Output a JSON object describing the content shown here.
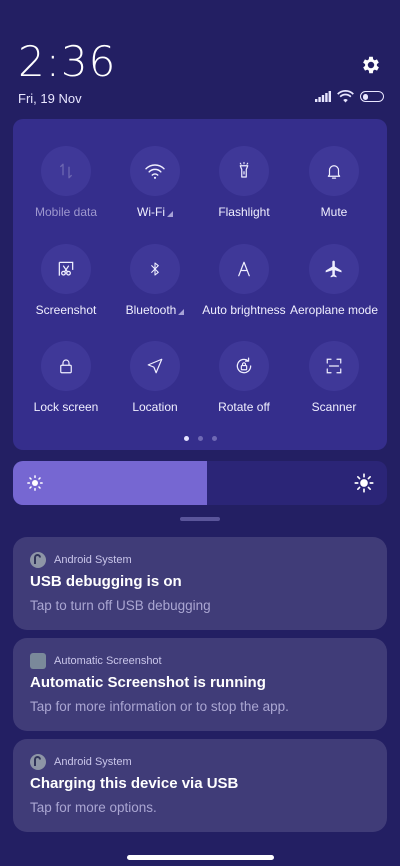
{
  "status_bar": {
    "time": "2:36",
    "date": "Fri, 19 Nov",
    "battery_level": 0.3
  },
  "quick_settings": {
    "tiles": [
      {
        "label": "Mobile data",
        "icon": "mobile-data-icon",
        "state": "disabled"
      },
      {
        "label": "Wi-Fi",
        "icon": "wifi-icon",
        "state": "off",
        "has_expand": true
      },
      {
        "label": "Flashlight",
        "icon": "flashlight-icon",
        "state": "off"
      },
      {
        "label": "Mute",
        "icon": "bell-icon",
        "state": "off"
      },
      {
        "label": "Screenshot",
        "icon": "scissors-icon",
        "state": "off"
      },
      {
        "label": "Bluetooth",
        "icon": "bluetooth-icon",
        "state": "off",
        "has_expand": true
      },
      {
        "label": "Auto brightness",
        "icon": "auto-brightness-icon",
        "state": "off"
      },
      {
        "label": "Aeroplane mode",
        "icon": "airplane-icon",
        "state": "off"
      },
      {
        "label": "Lock screen",
        "icon": "lock-icon",
        "state": "off"
      },
      {
        "label": "Location",
        "icon": "location-arrow-icon",
        "state": "off"
      },
      {
        "label": "Rotate off",
        "icon": "rotate-lock-icon",
        "state": "off"
      },
      {
        "label": "Scanner",
        "icon": "scanner-icon",
        "state": "off"
      }
    ],
    "pages": 3,
    "active_page": 0
  },
  "brightness": {
    "level_percent": 52
  },
  "notifications": [
    {
      "app": "Android System",
      "icon": "android-system-icon",
      "title": "USB debugging is on",
      "body": "Tap to turn off USB debugging"
    },
    {
      "app": "Automatic Screenshot",
      "icon": "automatic-screenshot-icon",
      "title": "Automatic Screenshot is running",
      "body": "Tap for more information or to stop the app."
    },
    {
      "app": "Android System",
      "icon": "android-system-icon",
      "title": "Charging this device via USB",
      "body": "Tap for more options."
    }
  ],
  "colors": {
    "background": "#231f63",
    "panel": "#352e8c",
    "tile": "#3f3898",
    "brightness_fill": "#7667d2",
    "notification": "#403c78"
  }
}
